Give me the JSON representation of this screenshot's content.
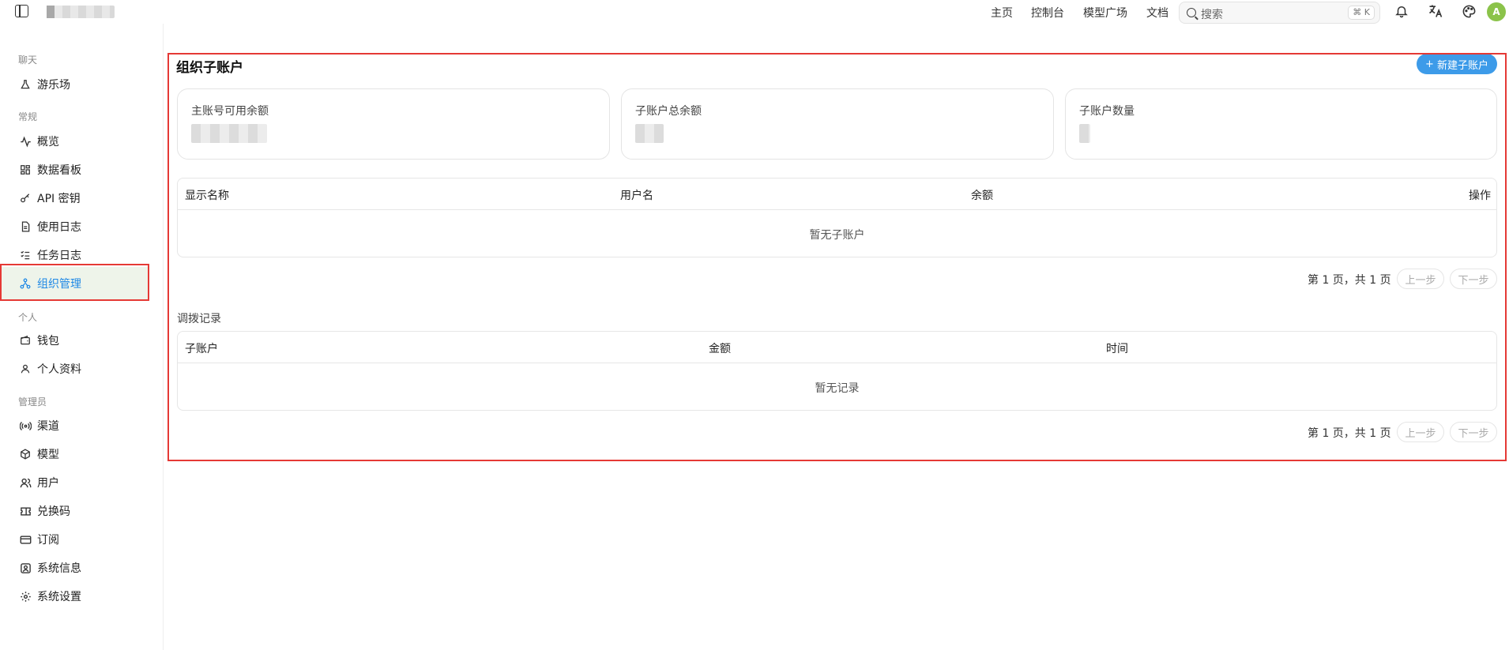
{
  "topbar": {
    "nav": [
      "主页",
      "控制台",
      "模型广场",
      "文档"
    ],
    "search_placeholder": "搜索",
    "search_shortcut": "⌘ K",
    "avatar_letter": "A"
  },
  "sidebar": {
    "sections": [
      {
        "label": "聊天",
        "items": [
          {
            "label": "游乐场",
            "icon": "flask-icon"
          }
        ]
      },
      {
        "label": "常规",
        "items": [
          {
            "label": "概览",
            "icon": "activity-icon"
          },
          {
            "label": "数据看板",
            "icon": "dashboard-grid-icon"
          },
          {
            "label": "API 密钥",
            "icon": "key-icon"
          },
          {
            "label": "使用日志",
            "icon": "document-icon"
          },
          {
            "label": "任务日志",
            "icon": "checklist-icon"
          },
          {
            "label": "组织管理",
            "icon": "org-tree-icon",
            "active": true
          }
        ]
      },
      {
        "label": "个人",
        "items": [
          {
            "label": "钱包",
            "icon": "wallet-icon"
          },
          {
            "label": "个人资料",
            "icon": "user-icon"
          }
        ]
      },
      {
        "label": "管理员",
        "items": [
          {
            "label": "渠道",
            "icon": "broadcast-icon"
          },
          {
            "label": "模型",
            "icon": "cube-icon"
          },
          {
            "label": "用户",
            "icon": "users-icon"
          },
          {
            "label": "兑换码",
            "icon": "ticket-icon"
          },
          {
            "label": "订阅",
            "icon": "card-icon"
          },
          {
            "label": "系统信息",
            "icon": "info-icon"
          },
          {
            "label": "系统设置",
            "icon": "gear-icon"
          }
        ]
      }
    ]
  },
  "main": {
    "title": "组织子账户",
    "new_button": "新建子账户",
    "stats": [
      {
        "label": "主账号可用余额"
      },
      {
        "label": "子账户总余额"
      },
      {
        "label": "子账户数量"
      }
    ],
    "accounts_table": {
      "columns": [
        "显示名称",
        "用户名",
        "余额",
        "操作"
      ],
      "empty_text": "暂无子账户",
      "pager": {
        "text": "第 1 页，共 1 页",
        "prev": "上一步",
        "next": "下一步"
      }
    },
    "records_title": "调拨记录",
    "records_table": {
      "columns": [
        "子账户",
        "金额",
        "时间"
      ],
      "empty_text": "暂无记录",
      "pager": {
        "text": "第 1 页，共 1 页",
        "prev": "上一步",
        "next": "下一步"
      }
    }
  },
  "colors": {
    "accent": "#3d9be9",
    "active_bg": "#eef4ea",
    "highlight": "#e53935",
    "avatar": "#8bc34a"
  }
}
